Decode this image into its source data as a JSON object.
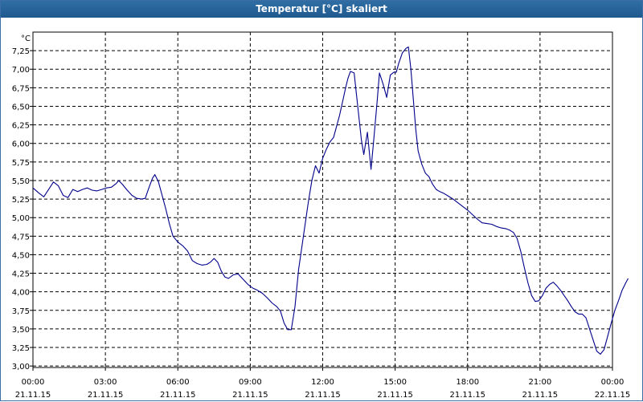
{
  "window": {
    "title": "Temperatur [°C] skaliert"
  },
  "chart_data": {
    "type": "line",
    "title": "Temperatur [°C] skaliert",
    "unit": "°C",
    "ylim": [
      3.0,
      7.25
    ],
    "y_ticks": [
      "7,25",
      "7,00",
      "6,75",
      "6,50",
      "6,25",
      "6,00",
      "5,75",
      "5,50",
      "5,25",
      "5,00",
      "4,75",
      "4,50",
      "4,25",
      "4,00",
      "3,75",
      "3,50",
      "3,25",
      "3,00"
    ],
    "x_ticks": [
      {
        "time": "00:00",
        "date": "21.11.15"
      },
      {
        "time": "03:00",
        "date": "21.11.15"
      },
      {
        "time": "06:00",
        "date": "21.11.15"
      },
      {
        "time": "09:00",
        "date": "21.11.15"
      },
      {
        "time": "12:00",
        "date": "21.11.15"
      },
      {
        "time": "15:00",
        "date": "21.11.15"
      },
      {
        "time": "18:00",
        "date": "21.11.15"
      },
      {
        "time": "21:00",
        "date": "21.11.15"
      },
      {
        "time": "00:00",
        "date": "22.11.15"
      }
    ],
    "grid": true,
    "series": [
      {
        "color": "#00008b",
        "points": [
          [
            0.0,
            5.4
          ],
          [
            0.25,
            5.33
          ],
          [
            0.45,
            5.28
          ],
          [
            0.65,
            5.38
          ],
          [
            0.85,
            5.48
          ],
          [
            1.05,
            5.43
          ],
          [
            1.25,
            5.3
          ],
          [
            1.45,
            5.27
          ],
          [
            1.65,
            5.38
          ],
          [
            1.85,
            5.35
          ],
          [
            2.05,
            5.38
          ],
          [
            2.25,
            5.4
          ],
          [
            2.45,
            5.37
          ],
          [
            2.65,
            5.36
          ],
          [
            2.85,
            5.38
          ],
          [
            3.05,
            5.4
          ],
          [
            3.25,
            5.41
          ],
          [
            3.45,
            5.46
          ],
          [
            3.55,
            5.5
          ],
          [
            3.7,
            5.45
          ],
          [
            3.9,
            5.37
          ],
          [
            4.1,
            5.3
          ],
          [
            4.3,
            5.26
          ],
          [
            4.5,
            5.25
          ],
          [
            4.65,
            5.26
          ],
          [
            4.8,
            5.4
          ],
          [
            4.95,
            5.53
          ],
          [
            5.05,
            5.58
          ],
          [
            5.2,
            5.48
          ],
          [
            5.35,
            5.3
          ],
          [
            5.5,
            5.12
          ],
          [
            5.65,
            4.92
          ],
          [
            5.8,
            4.75
          ],
          [
            6.0,
            4.67
          ],
          [
            6.2,
            4.62
          ],
          [
            6.4,
            4.55
          ],
          [
            6.6,
            4.42
          ],
          [
            6.8,
            4.38
          ],
          [
            7.0,
            4.36
          ],
          [
            7.2,
            4.37
          ],
          [
            7.35,
            4.4
          ],
          [
            7.5,
            4.45
          ],
          [
            7.65,
            4.4
          ],
          [
            7.8,
            4.28
          ],
          [
            7.95,
            4.2
          ],
          [
            8.1,
            4.18
          ],
          [
            8.3,
            4.23
          ],
          [
            8.5,
            4.24
          ],
          [
            8.7,
            4.17
          ],
          [
            8.9,
            4.1
          ],
          [
            9.1,
            4.05
          ],
          [
            9.3,
            4.02
          ],
          [
            9.5,
            3.98
          ],
          [
            9.7,
            3.92
          ],
          [
            9.9,
            3.85
          ],
          [
            10.1,
            3.8
          ],
          [
            10.25,
            3.74
          ],
          [
            10.4,
            3.58
          ],
          [
            10.55,
            3.49
          ],
          [
            10.7,
            3.49
          ],
          [
            10.85,
            3.8
          ],
          [
            11.0,
            4.3
          ],
          [
            11.2,
            4.75
          ],
          [
            11.4,
            5.2
          ],
          [
            11.55,
            5.5
          ],
          [
            11.7,
            5.7
          ],
          [
            11.85,
            5.6
          ],
          [
            12.0,
            5.8
          ],
          [
            12.15,
            5.92
          ],
          [
            12.3,
            6.02
          ],
          [
            12.45,
            6.08
          ],
          [
            12.55,
            6.2
          ],
          [
            12.7,
            6.38
          ],
          [
            12.85,
            6.6
          ],
          [
            12.95,
            6.75
          ],
          [
            13.05,
            6.88
          ],
          [
            13.15,
            6.97
          ],
          [
            13.3,
            6.95
          ],
          [
            13.45,
            6.5
          ],
          [
            13.6,
            6.05
          ],
          [
            13.7,
            5.85
          ],
          [
            13.85,
            6.15
          ],
          [
            14.0,
            5.65
          ],
          [
            14.1,
            6.0
          ],
          [
            14.25,
            6.55
          ],
          [
            14.35,
            6.95
          ],
          [
            14.5,
            6.8
          ],
          [
            14.65,
            6.62
          ],
          [
            14.8,
            6.92
          ],
          [
            14.95,
            6.96
          ],
          [
            15.05,
            6.96
          ],
          [
            15.15,
            7.08
          ],
          [
            15.3,
            7.22
          ],
          [
            15.45,
            7.28
          ],
          [
            15.55,
            7.3
          ],
          [
            15.65,
            7.0
          ],
          [
            15.75,
            6.6
          ],
          [
            15.85,
            6.2
          ],
          [
            15.95,
            5.9
          ],
          [
            16.1,
            5.72
          ],
          [
            16.25,
            5.6
          ],
          [
            16.4,
            5.55
          ],
          [
            16.55,
            5.45
          ],
          [
            16.7,
            5.38
          ],
          [
            16.85,
            5.35
          ],
          [
            17.0,
            5.33
          ],
          [
            17.2,
            5.29
          ],
          [
            17.4,
            5.25
          ],
          [
            17.6,
            5.2
          ],
          [
            17.8,
            5.15
          ],
          [
            18.0,
            5.1
          ],
          [
            18.2,
            5.04
          ],
          [
            18.4,
            4.98
          ],
          [
            18.6,
            4.93
          ],
          [
            18.8,
            4.92
          ],
          [
            19.0,
            4.91
          ],
          [
            19.2,
            4.88
          ],
          [
            19.4,
            4.86
          ],
          [
            19.6,
            4.85
          ],
          [
            19.75,
            4.83
          ],
          [
            19.9,
            4.8
          ],
          [
            20.05,
            4.72
          ],
          [
            20.2,
            4.55
          ],
          [
            20.35,
            4.33
          ],
          [
            20.5,
            4.12
          ],
          [
            20.65,
            3.95
          ],
          [
            20.8,
            3.87
          ],
          [
            20.95,
            3.88
          ],
          [
            21.1,
            3.95
          ],
          [
            21.25,
            4.05
          ],
          [
            21.4,
            4.1
          ],
          [
            21.55,
            4.13
          ],
          [
            21.7,
            4.08
          ],
          [
            21.85,
            4.02
          ],
          [
            22.0,
            3.95
          ],
          [
            22.15,
            3.88
          ],
          [
            22.3,
            3.8
          ],
          [
            22.45,
            3.73
          ],
          [
            22.6,
            3.7
          ],
          [
            22.75,
            3.7
          ],
          [
            22.9,
            3.65
          ],
          [
            23.05,
            3.5
          ],
          [
            23.2,
            3.35
          ],
          [
            23.35,
            3.2
          ],
          [
            23.5,
            3.16
          ],
          [
            23.65,
            3.22
          ],
          [
            23.8,
            3.4
          ],
          [
            23.95,
            3.58
          ],
          [
            24.1,
            3.75
          ],
          [
            24.25,
            3.88
          ],
          [
            24.4,
            4.02
          ],
          [
            24.55,
            4.12
          ],
          [
            24.65,
            4.18
          ]
        ]
      }
    ]
  }
}
